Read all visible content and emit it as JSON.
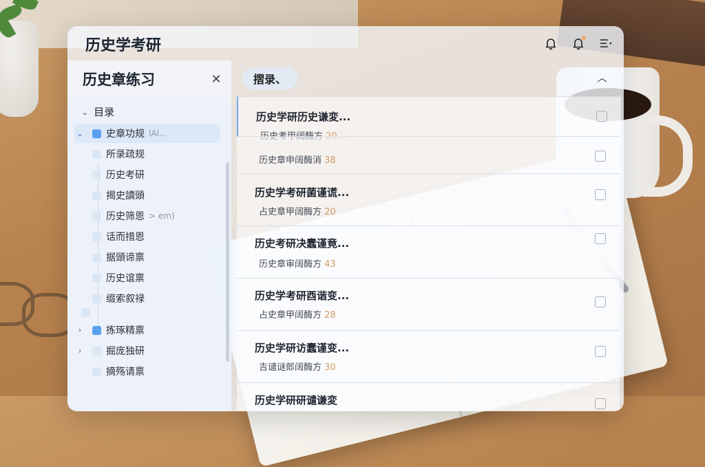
{
  "app": {
    "title": "历史学考研"
  },
  "topbar": {
    "icons": [
      "bell-icon",
      "bell-alert-icon",
      "menu-icon"
    ]
  },
  "sidebar": {
    "title": "历史章练习",
    "tree_header": "目录",
    "items": [
      {
        "label": "史章功规",
        "extra": "lAl...",
        "selected": true,
        "caret": "open"
      },
      {
        "label": "所录疏规"
      },
      {
        "label": "历史考研"
      },
      {
        "label": "揭史讀頭"
      },
      {
        "label": "历史筛恩",
        "extra": "> em)"
      },
      {
        "label": "话而措恩"
      },
      {
        "label": "据頭谛禀"
      },
      {
        "label": "历史谊禀"
      },
      {
        "label": "缀索叙禄"
      },
      {
        "label": "拣琢精禀",
        "caret": "closed"
      },
      {
        "label": "掘庞独研",
        "caret": "closed"
      },
      {
        "label": "摘殇请禀"
      }
    ]
  },
  "main": {
    "filter_label": "摺录、",
    "cards": [
      {
        "title": "历史学研历史谦変...",
        "sub": "历史考甲阔酶方",
        "num": "20..."
      },
      {
        "title": "",
        "sub": "历史章申阔酶消",
        "num": "38"
      },
      {
        "title": "历史学考研菌谨谎...",
        "sub": "占史章甲阔酶方",
        "num": "20"
      },
      {
        "title": "历史考研决蠢谨竟...",
        "sub": "历史章审阔酶方",
        "num": "43"
      },
      {
        "title": "历史学考研酉谐变...",
        "sub": "占史章甲阔酶方",
        "num": "28"
      },
      {
        "title": "历史学研访蠢谨变...",
        "sub": "吉谴谜郎阔酶方",
        "num": "30"
      },
      {
        "title": "历史学研研谴谦変",
        "sub": "",
        "num": ""
      }
    ]
  }
}
